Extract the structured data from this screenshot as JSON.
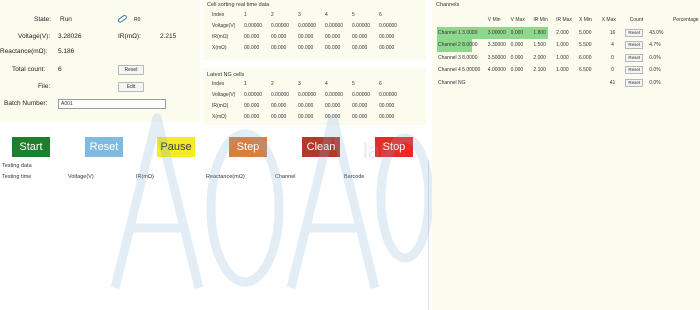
{
  "status": {
    "state_label": "State:",
    "state_value": "Run",
    "r0_label": "R0",
    "voltage_label": "Voltage(V):",
    "voltage_value": "3.28026",
    "ir_label": "IR(mΩ):",
    "ir_value": "2.215",
    "reactance_label": "Reactance(mΩ):",
    "reactance_value": "5.186",
    "total_label": "Total count:",
    "total_value": "6",
    "reset_label": "Reset",
    "file_label": "File:",
    "edit_label": "Edit",
    "batch_label": "Batch Number:",
    "batch_value": "A001"
  },
  "realtime": {
    "title": "Cell sorting real time data",
    "header": [
      "Index",
      "1",
      "2",
      "3",
      "4",
      "5",
      "6"
    ],
    "rows": [
      [
        "Voltage(V)",
        "0.00000",
        "0.00000",
        "0.00000",
        "0.00000",
        "0.00000",
        "0.00000"
      ],
      [
        "IR(mΩ)",
        "00.000",
        "00.000",
        "00.000",
        "00.000",
        "00.000",
        "00.000"
      ],
      [
        "X(mΩ)",
        "00.000",
        "00.000",
        "00.000",
        "00.000",
        "00.000",
        "00.000"
      ]
    ]
  },
  "latest_ng": {
    "title": "Latest NG cells",
    "header": [
      "Index",
      "1",
      "2",
      "3",
      "4",
      "5",
      "6"
    ],
    "rows": [
      [
        "Voltage(V)",
        "0.00000",
        "0.00000",
        "0.00000",
        "0.00000",
        "0.00000",
        "0.00000"
      ],
      [
        "IR(mΩ)",
        "00.000",
        "00.000",
        "00.000",
        "00.000",
        "00.000",
        "00.000"
      ],
      [
        "X(mΩ)",
        "00.000",
        "00.000",
        "00.000",
        "00.000",
        "00.000",
        "00.000"
      ]
    ]
  },
  "buttons": {
    "start": "Start",
    "reset": "Reset",
    "pause": "Pause",
    "step": "Step",
    "clean": "Clean",
    "stop": "Stop"
  },
  "testing": {
    "title": "Testing data",
    "columns": [
      "Testing time",
      "Voltage(V)",
      "IR(mΩ)",
      "Reactance(mΩ)",
      "Channel",
      "Barcode"
    ]
  },
  "channels": {
    "title": "Channels",
    "columns": [
      "",
      "V Min",
      "V Max",
      "IR Min",
      "IR Max",
      "X Min",
      "X Max",
      "Count",
      "",
      "Percentage"
    ],
    "rows": [
      [
        "Channel 1 3.0000",
        "3.00000",
        "0.000",
        "1.800",
        "2.000",
        "5.000",
        "16",
        "Reset",
        "43.0%"
      ],
      [
        "Channel 2 8.0000",
        "3.30000",
        "0.000",
        "1.500",
        "1.000",
        "5.500",
        "4",
        "Reset",
        "4.7%"
      ],
      [
        "Channel 3 8.0000",
        "3.50000",
        "0.000",
        "2.000",
        "1.000",
        "6.000",
        "0",
        "Reset",
        "0.0%"
      ],
      [
        "Channel 4 5.00000",
        "4.00000",
        "0.000",
        "2.100",
        "1.000",
        "6.500",
        "0",
        "Reset",
        "0.0%"
      ],
      [
        "Channel NG",
        "",
        "",
        "",
        "",
        "",
        "41",
        "Reset",
        "0.0%"
      ]
    ]
  },
  "watermark": "AOAO lab",
  "colors": {
    "start": "#1f7d2e",
    "reset": "#7fbbe0",
    "pause": "#f4ec20",
    "step": "#d77f43",
    "clean": "#b23a2c",
    "stop": "#e82a22",
    "highlight": "#8ed88e",
    "panel": "#fbfbee"
  }
}
